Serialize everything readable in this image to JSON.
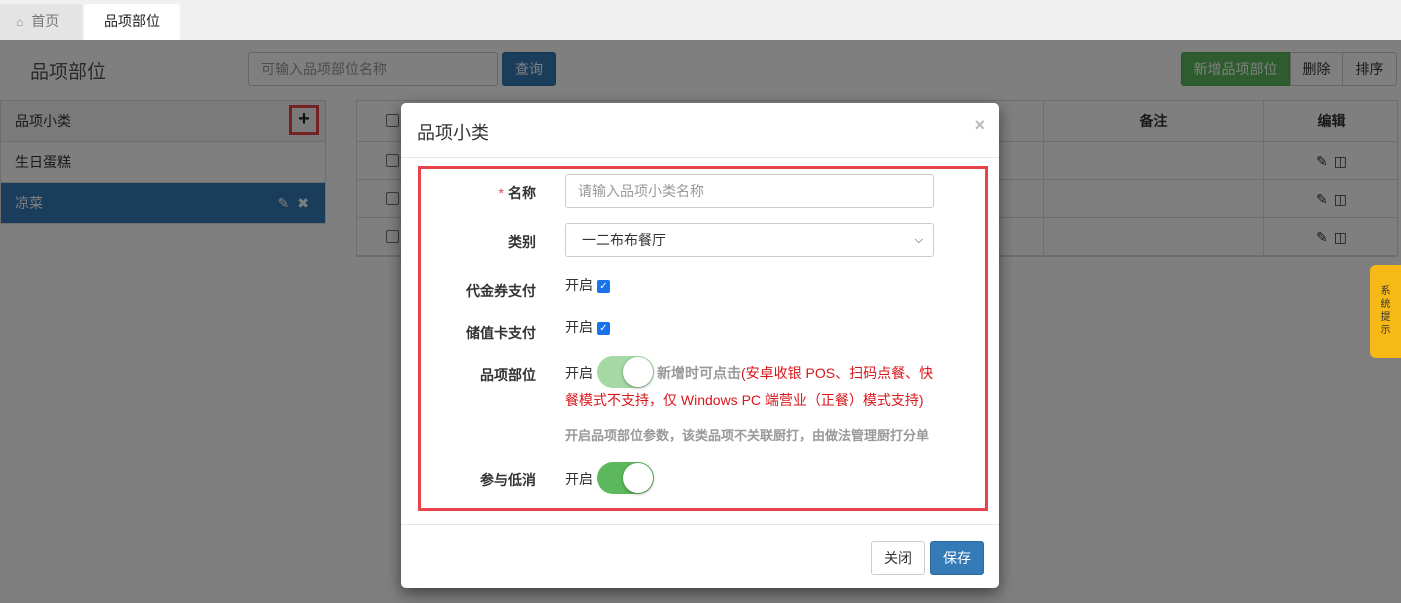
{
  "tabs": [
    {
      "label": "首页",
      "icon": "home-icon"
    },
    {
      "label": "品项部位",
      "active": true
    }
  ],
  "header": {
    "title": "品项部位",
    "search_placeholder": "可输入品项部位名称",
    "query_label": "查询",
    "add_label": "新增品项部位",
    "delete_label": "删除",
    "sort_label": "排序"
  },
  "sidebar": {
    "title": "品项小类",
    "items": [
      {
        "label": "生日蛋糕",
        "selected": false
      },
      {
        "label": "凉菜",
        "selected": true
      }
    ]
  },
  "table": {
    "columns": [
      "备注",
      "编辑"
    ],
    "rows": 3
  },
  "side_tab": {
    "label": "系统提示"
  },
  "modal": {
    "title": "品项小类",
    "close_symbol": "×",
    "fields": {
      "name": {
        "label": "名称",
        "required_mark": "*",
        "placeholder": "请输入品项小类名称"
      },
      "category": {
        "label": "类别",
        "value": "一二布布餐厅"
      },
      "voucher_pay": {
        "label": "代金券支付",
        "state_label": "开启",
        "checked": true
      },
      "stored_card_pay": {
        "label": "储值卡支付",
        "state_label": "开启",
        "checked": true
      },
      "item_part": {
        "label": "品项部位",
        "state_label": "开启",
        "note_gray": "新增时可点击",
        "note_red_1": "(安卓收银 POS、扫码点餐、快",
        "note_red_2": "餐模式不支持，仅 Windows PC 端营业（正餐）模式支持)",
        "hint": "开启品项部位参数，该类品项不关联厨打，由做法管理厨打分单"
      },
      "min_spend": {
        "label": "参与低消",
        "state_label": "开启"
      }
    },
    "close_label": "关闭",
    "save_label": "保存"
  },
  "colors": {
    "primary": "#337ab7",
    "success": "#5cb85c",
    "highlight": "#e8434a",
    "warning_tab": "#f7b916",
    "note_red": "#d9161b"
  }
}
